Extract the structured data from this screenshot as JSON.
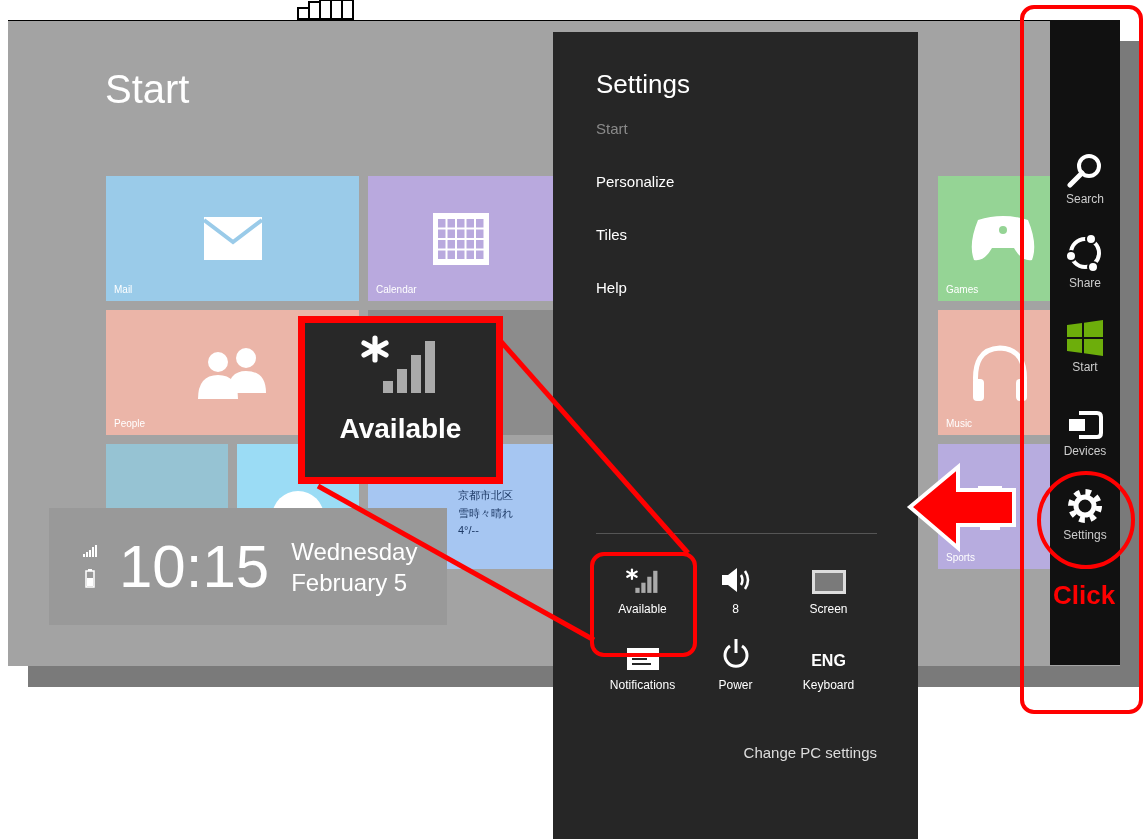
{
  "start_screen": {
    "title": "Start",
    "tiles": [
      {
        "kind": "mail",
        "label": "Mail",
        "color": "#9acbe9"
      },
      {
        "kind": "calendar",
        "label": "Calendar",
        "color": "#b9a9de"
      },
      {
        "kind": "people",
        "label": "People",
        "color": "#ebb5a8"
      },
      {
        "kind": "photo",
        "color": "#8c8c8c"
      },
      {
        "kind": "plain",
        "color": "#96c3d3"
      },
      {
        "kind": "skype",
        "color": "#9bdcf5"
      },
      {
        "kind": "weather",
        "color": "#a6c6f2",
        "lines": [
          "京都市北区",
          "雪時々晴れ",
          "4°/--"
        ]
      },
      {
        "kind": "games",
        "label": "Games",
        "color": "#95d495"
      },
      {
        "kind": "music",
        "label": "Music",
        "color": "#ebb5a8"
      },
      {
        "kind": "sports",
        "label": "Sports",
        "color": "#b7acdf"
      }
    ],
    "clock": {
      "time": "10:15",
      "day": "Wednesday",
      "date": "February 5"
    }
  },
  "settings_panel": {
    "title": "Settings",
    "context": "Start",
    "items": [
      "Personalize",
      "Tiles",
      "Help"
    ],
    "quick_settings": [
      {
        "kind": "network",
        "label": "Available"
      },
      {
        "kind": "volume",
        "label": "8"
      },
      {
        "kind": "screen",
        "label": "Screen"
      },
      {
        "kind": "notifications",
        "label": "Notifications"
      },
      {
        "kind": "power",
        "label": "Power"
      },
      {
        "kind": "keyboard",
        "label": "Keyboard",
        "glyph": "ENG"
      }
    ],
    "footer_link": "Change PC settings"
  },
  "charms": [
    {
      "kind": "search",
      "label": "Search"
    },
    {
      "kind": "share",
      "label": "Share"
    },
    {
      "kind": "start",
      "label": "Start"
    },
    {
      "kind": "devices",
      "label": "Devices"
    },
    {
      "kind": "settings",
      "label": "Settings"
    }
  ],
  "callout": {
    "label": "Available"
  },
  "annotation": {
    "text": "Click"
  }
}
